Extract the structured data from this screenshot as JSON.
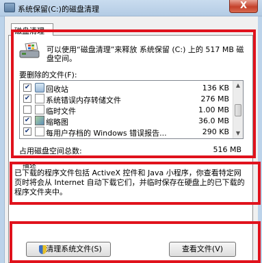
{
  "window": {
    "title": "系统保留(C:)的磁盘清理",
    "close_label": "X"
  },
  "tab": {
    "label": "磁盘清理"
  },
  "info": {
    "text": "可以使用“磁盘清理”来释放 系统保留 (C:) 上的 517 MB 磁盘空间。"
  },
  "files": {
    "label": "要删除的文件(F):",
    "items": [
      {
        "checked": true,
        "icon": "recycle-bin-icon",
        "name": "回收站",
        "size": "136 KB"
      },
      {
        "checked": true,
        "icon": "file-icon",
        "name": "系统错误内存转储文件",
        "size": "276 MB"
      },
      {
        "checked": false,
        "icon": "file-icon",
        "name": "临时文件",
        "size": "1.00 MB"
      },
      {
        "checked": true,
        "icon": "thumbnail-icon",
        "name": "缩略图",
        "size": "36.0 MB"
      },
      {
        "checked": true,
        "icon": "file-icon",
        "name": "每用户存档的 Windows 错误报告...",
        "size": "290 KB"
      }
    ]
  },
  "total": {
    "label": "占用磁盘空间总数:",
    "value": "516 MB"
  },
  "description": {
    "label": "描述",
    "text": "已下载的程序文件包括 ActiveX 控件和 Java 小程序，你查看特定网页时将会从 Internet 自动下载它们，并临时保存在硬盘上的已下载的程序文件夹中。"
  },
  "buttons": {
    "clean_system": "清理系统文件(S)",
    "view_files": "查看文件(V)"
  },
  "colors": {
    "highlight_border": "#e0121c",
    "titlebar": "#c9dcef",
    "close_button": "#c5412b"
  }
}
